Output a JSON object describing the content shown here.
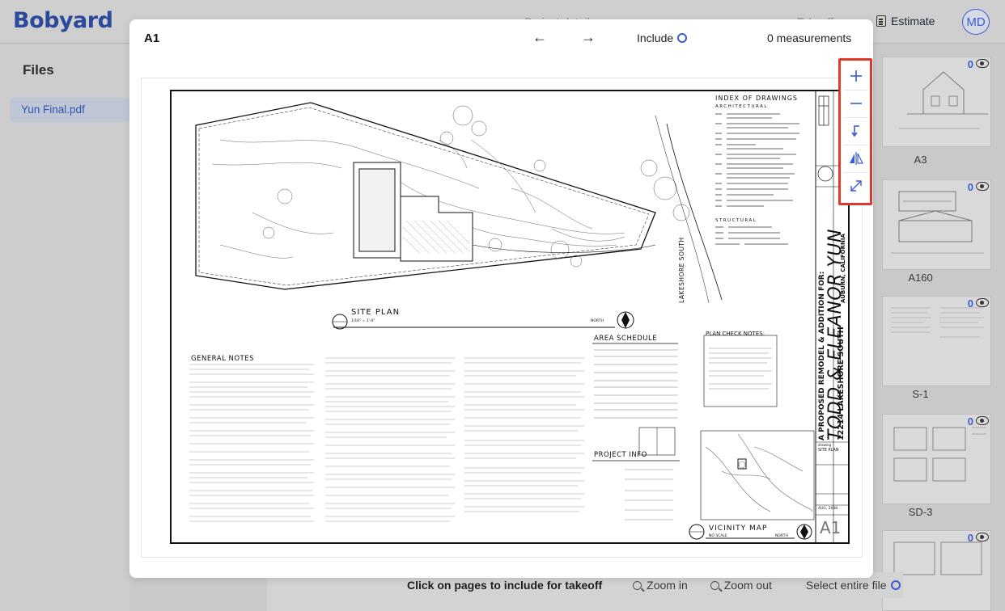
{
  "app": {
    "logo": "Bobyard",
    "header_faint": [
      "Project details",
      "Takeoff"
    ],
    "estimate_label": "Estimate",
    "avatar_initials": "MD"
  },
  "files_panel": {
    "title": "Files",
    "items": [
      "Yun Final.pdf"
    ]
  },
  "thumbnails": [
    {
      "label": "A3",
      "count": "0"
    },
    {
      "label": "A160",
      "count": "0"
    },
    {
      "label": "S-1",
      "count": "0"
    },
    {
      "label": "SD-3",
      "count": "0"
    },
    {
      "label": "",
      "count": "0"
    }
  ],
  "bottom_bar": {
    "instruction": "Click on pages to include for takeoff",
    "zoom_in": "Zoom in",
    "zoom_out": "Zoom out",
    "select_all": "Select entire file"
  },
  "modal": {
    "title": "A1",
    "prev_arrow": "←",
    "next_arrow": "→",
    "include_label": "Include",
    "measurements": "0 measurements",
    "zoom_tools": [
      "zoom-in",
      "zoom-out",
      "rotate",
      "flip",
      "fit-screen"
    ]
  },
  "sheet": {
    "index_title": "INDEX OF DRAWINGS",
    "architectural": "ARCHITECTURAL",
    "structural": "STRUCTURAL",
    "site_plan": "SITE PLAN",
    "site_plan_scale": "1/16\" = 1'-0\"",
    "north": "NORTH",
    "general_notes": "GENERAL NOTES",
    "area_schedule": "AREA SCHEDULE",
    "plan_check_notes": "PLAN CHECK NOTES:",
    "project_info": "PROJECT INFO",
    "vicinity_map": "VICINITY MAP",
    "vicinity_scale": "NO SCALE",
    "street": "LAKESHORE SOUTH",
    "owner_big": "TODD & ELEANOR YUN",
    "address_big": "12214 LAKESHORE SOUTH",
    "city_big": "AUBURN, CALIFORNIA",
    "proposal": "A PROPOSED REMODEL & ADDITION FOR:",
    "drawing_label": "drawing",
    "drawing_name": "SITE PLAN",
    "date": "AUG. 2008",
    "sheet_number": "A1"
  }
}
